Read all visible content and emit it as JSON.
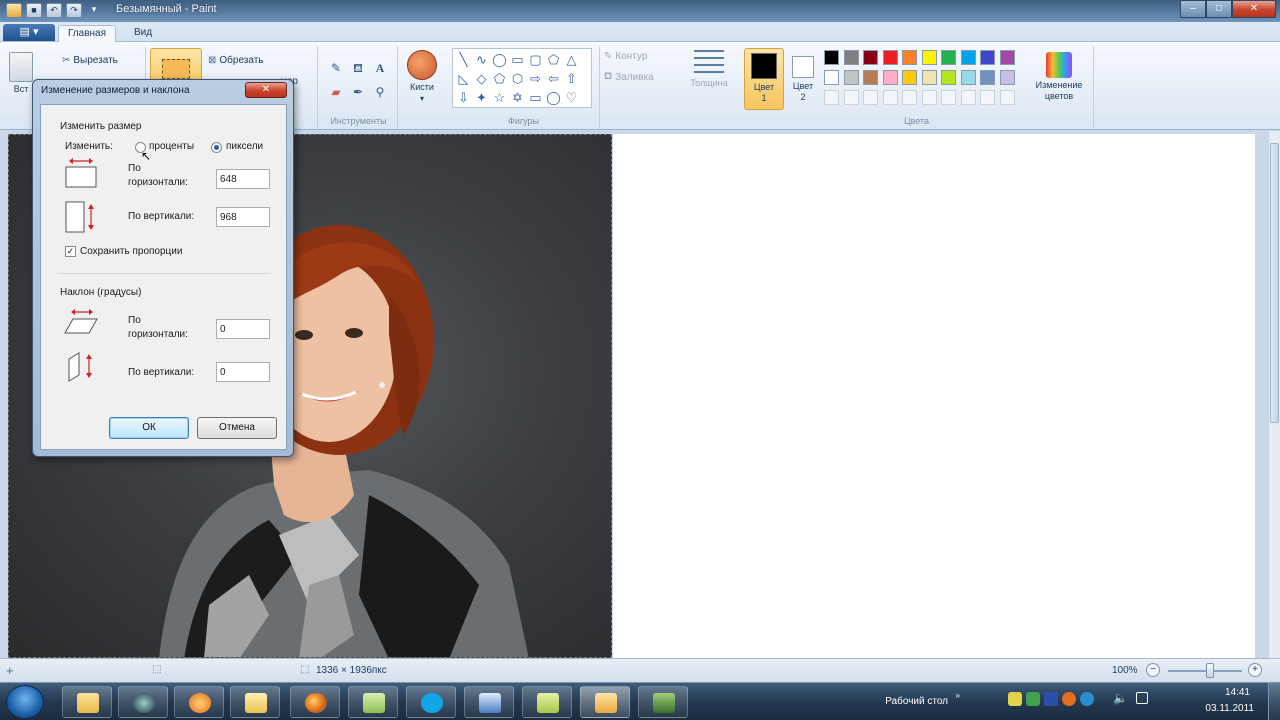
{
  "window": {
    "title": "Безымянный - Paint",
    "minimize": "–",
    "maximize": "□",
    "close": "✕"
  },
  "quick_access": {
    "save": "■",
    "undo": "↶",
    "redo": "↷",
    "more": "▾"
  },
  "ribbon_tabs": {
    "file": "▤ ▾",
    "home": "Главная",
    "view": "Вид"
  },
  "ribbon": {
    "clipboard": {
      "paste": "Вст",
      "cut": "Вырезать"
    },
    "image": {
      "crop": "Обрезать",
      "extra": "мер"
    },
    "tools_group": "Инструменты",
    "brushes": "Кисти",
    "shapes_group": "Фигуры",
    "outline": "Контур",
    "fill": "Заливка",
    "thickness": "Толщина",
    "color1": [
      "Цвет",
      "1"
    ],
    "color2": [
      "Цвет",
      "2"
    ],
    "colors_group": "Цвета",
    "edit_colors": [
      "Изменение",
      "цветов"
    ]
  },
  "palette_row1": [
    "#000000",
    "#7f7f7f",
    "#880015",
    "#ed1c24",
    "#ff7f27",
    "#fff200",
    "#22b14c",
    "#00a2e8",
    "#3f48cc",
    "#a349a4"
  ],
  "palette_row2": [
    "#ffffff",
    "#c3c3c3",
    "#b97a57",
    "#ffaec9",
    "#ffc90e",
    "#efe4b0",
    "#b5e61d",
    "#99d9ea",
    "#7092be",
    "#c8bfe7"
  ],
  "dialog": {
    "title": "Изменение размеров и наклона",
    "close": "✕",
    "resize_section": "Изменить размер",
    "by_label": "Изменить:",
    "percent": "проценты",
    "pixels": "пиксели",
    "horizontal": [
      "По",
      "горизонтали:"
    ],
    "horizontal_value": "648",
    "vertical": "По вертикали:",
    "vertical_value": "968",
    "keep_ratio": "Сохранить пропорции",
    "skew_section": "Наклон (градусы)",
    "skew_horizontal": [
      "По",
      "горизонтали:"
    ],
    "skew_horizontal_value": "0",
    "skew_vertical": "По вертикали:",
    "skew_vertical_value": "0",
    "ok": "ОК",
    "cancel": "Отмена"
  },
  "statusbar": {
    "add": "+",
    "dimensions": "1336 × 1936пкс",
    "zoom": "100%",
    "zoom_out": "−",
    "zoom_in": "+"
  },
  "taskbar": {
    "desktop": "Рабочий стол",
    "time": "14:41",
    "date": "03.11.2011"
  }
}
